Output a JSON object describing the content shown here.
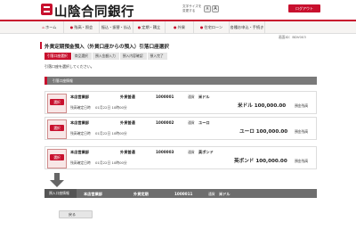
{
  "header": {
    "bank_name": "山陰合同銀行",
    "fontsize_label": "文字サイズを変更する",
    "fontsize_small": "A",
    "fontsize_large": "A",
    "logout_label": "ログアウト"
  },
  "nav": {
    "items": [
      {
        "label": "ホーム",
        "icon": "home-icon"
      },
      {
        "label": "残高・照会"
      },
      {
        "label": "振込・振替・払込"
      },
      {
        "label": "定期・積立"
      },
      {
        "label": "外貨"
      },
      {
        "label": "住宅ローン"
      },
      {
        "label": "各種お申込・手続き"
      }
    ]
  },
  "page": {
    "screen_number": "画面ID：BDV003",
    "title": "外貨定期預金預入（外貨口座からの預入）引落口座選択",
    "steps": [
      "引落口座選択",
      "商品選択",
      "預入金額入力",
      "預入内容確認",
      "預入完了"
    ],
    "instruction": "引落口座を選択してください。",
    "list_header": "引落口座情報",
    "select_label": "選択",
    "rows": [
      {
        "branch": "本店営業部",
        "type": "外貨普通",
        "account": "1000001",
        "currency_label": "通貨",
        "currency": "米ドル",
        "date_label": "残高確定日時",
        "date": "01月22日 10時00分",
        "amount": "米ドル 100,000.00",
        "balance_label": "預金残高"
      },
      {
        "branch": "本店営業部",
        "type": "外貨普通",
        "account": "1000002",
        "currency_label": "通貨",
        "currency": "ユーロ",
        "date_label": "残高確定日時",
        "date": "01月22日 10時00分",
        "amount": "ユーロ 100,000.00",
        "balance_label": "預金残高"
      },
      {
        "branch": "本店営業部",
        "type": "外貨普通",
        "account": "1000003",
        "currency_label": "通貨",
        "currency": "英ポンド",
        "date_label": "残高確定日時",
        "date": "01月22日 10時00分",
        "amount": "英ポンド 100,000.00",
        "balance_label": "預金残高"
      }
    ],
    "destination": {
      "label": "預入口座情報",
      "branch": "本店営業部",
      "type": "外貨定期",
      "account": "1000011",
      "currency_label": "通貨",
      "currency": "米ドル"
    },
    "back_label": "戻る"
  },
  "colors": {
    "brand_red": "#c8102e",
    "header_gray": "#7a7a7a"
  }
}
